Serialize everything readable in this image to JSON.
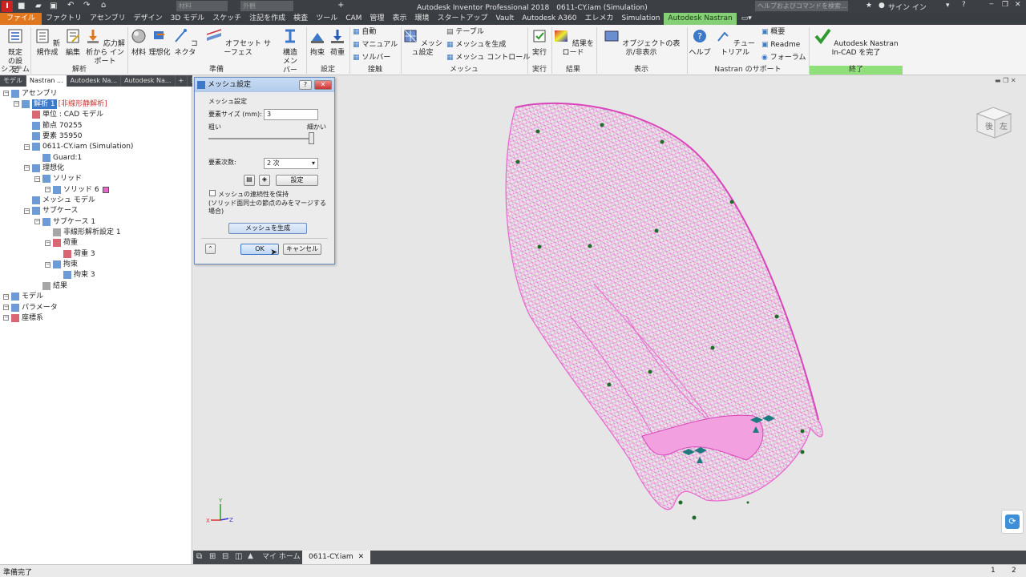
{
  "title_bar": {
    "window_title": "Autodesk Inventor Professional 2018　0611-CY.iam (Simulation)",
    "search_placeholder": "ヘルプおよびコマンドを検索...",
    "sign_in": "サイン イン",
    "material_field": "材料",
    "appearance_field": "外観"
  },
  "tabs": [
    "ファイル",
    "ファクトリ",
    "アセンブリ",
    "デザイン",
    "3D モデル",
    "スケッチ",
    "注記を作成",
    "検査",
    "ツール",
    "CAM",
    "管理",
    "表示",
    "環境",
    "スタートアップ",
    "Vault",
    "Autodesk A360",
    "エレメカ",
    "Simulation",
    "Autodesk Nastran"
  ],
  "ribbon": {
    "system": {
      "buttons": [
        "既定の設定"
      ],
      "group": "システム"
    },
    "analysis": {
      "buttons": [
        "新規作成",
        "編集",
        "応力解析から インポート"
      ],
      "group": "解析"
    },
    "prepare": {
      "buttons": [
        "材料",
        "理想化",
        "コネクタ",
        "オフセット サーフェス",
        "構造メンバー"
      ],
      "group": "準備"
    },
    "settings": {
      "buttons": [
        "拘束",
        "荷重"
      ],
      "group": "設定"
    },
    "contacts": {
      "items": [
        "自動",
        "マニュアル",
        "ソルバー"
      ],
      "group": "接触"
    },
    "mesh": {
      "buttons": [
        "メッシュ設定"
      ],
      "items": [
        "テーブル",
        "メッシュを生成",
        "メッシュ コントロール"
      ],
      "group": "メッシュ"
    },
    "run": {
      "buttons": [
        "実行"
      ],
      "group": "実行"
    },
    "results": {
      "buttons": [
        "結果をロード"
      ],
      "group": "結果"
    },
    "display": {
      "buttons": [
        "オブジェクトの表示/非表示"
      ],
      "group": "表示"
    },
    "support": {
      "buttons": [
        "ヘルプ",
        "チュートリアル"
      ],
      "items": [
        "概要",
        "Readme",
        "フォーラム"
      ],
      "group": "Nastran のサポート"
    },
    "finish": {
      "buttons": [
        "Autodesk Nastran In-CAD を完了"
      ],
      "group": "終了"
    }
  },
  "browser": {
    "tabs": [
      "モデル",
      "Nastran ...",
      "Autodesk Na...",
      "Autodesk Na..."
    ],
    "tree": [
      {
        "label": "アセンブリ",
        "level": 0,
        "icon": "assembly-icon"
      },
      {
        "label": "解析 1",
        "suffix": "[非線形静解析]",
        "level": 1,
        "icon": "analysis-icon",
        "selected": true
      },
      {
        "label": "単位 : CAD モデル",
        "level": 2,
        "icon": "units-icon"
      },
      {
        "label": "節点 70255",
        "level": 2,
        "icon": "node-icon"
      },
      {
        "label": "要素 35950",
        "level": 2,
        "icon": "element-icon"
      },
      {
        "label": "0611-CY.iam (Simulation)",
        "level": 2,
        "icon": "assembly-icon"
      },
      {
        "label": "Guard:1",
        "level": 3,
        "icon": "part-icon"
      },
      {
        "label": "理想化",
        "level": 2,
        "icon": "idealization-icon"
      },
      {
        "label": "ソリッド",
        "level": 3,
        "icon": "solid-icon"
      },
      {
        "label": "ソリッド 6",
        "level": 4,
        "icon": "solid-icon",
        "swatch": true
      },
      {
        "label": "メッシュ モデル",
        "level": 2,
        "icon": "mesh-model-icon"
      },
      {
        "label": "サブケース",
        "level": 2,
        "icon": "subcase-icon"
      },
      {
        "label": "サブケース 1",
        "level": 3,
        "icon": "subcase-icon"
      },
      {
        "label": "非線形解析設定 1",
        "level": 4,
        "icon": "settings-icon"
      },
      {
        "label": "荷重",
        "level": 4,
        "icon": "load-icon"
      },
      {
        "label": "荷重 3",
        "level": 5,
        "icon": "load-icon"
      },
      {
        "label": "拘束",
        "level": 4,
        "icon": "constraint-icon"
      },
      {
        "label": "拘束 3",
        "level": 5,
        "icon": "constraint-icon"
      },
      {
        "label": "結果",
        "level": 3,
        "icon": "results-icon"
      },
      {
        "label": "モデル",
        "level": 0,
        "icon": "model-icon"
      },
      {
        "label": "パラメータ",
        "level": 0,
        "icon": "parameter-icon"
      },
      {
        "label": "座標系",
        "level": 0,
        "icon": "coordinate-icon"
      }
    ]
  },
  "dialog": {
    "title": "メッシュ設定",
    "section": "メッシュ設定",
    "element_size_label": "要素サイズ (mm):",
    "element_size_value": "3",
    "coarse": "粗い",
    "fine": "細かい",
    "element_order_label": "要素次数:",
    "element_order_value": "2 次",
    "settings_button": "設定",
    "continuity_checkbox": "メッシュの連続性を保持",
    "continuity_note": "(ソリッド面同士の節点のみをマージする場合)",
    "generate_button": "メッシュを生成",
    "ok": "OK",
    "cancel": "キャンセル",
    "help": "?",
    "close": "✕"
  },
  "viewcube": {
    "faces": [
      "後",
      "左"
    ]
  },
  "axis_labels": {
    "x": "X",
    "y": "Y",
    "z": "Z"
  },
  "bottom_tabs": {
    "home": "マイ ホーム",
    "doc": "0611-CY.iam"
  },
  "status": {
    "text": "準備完了",
    "page1": "1",
    "page2": "2"
  },
  "colors": {
    "mesh": "#e966cf",
    "active_tab": "#85d076",
    "file_tab": "#e0771e",
    "finish_group": "#8fe07a",
    "constraint": "#1f7a80",
    "load": "#1e6b2a"
  }
}
